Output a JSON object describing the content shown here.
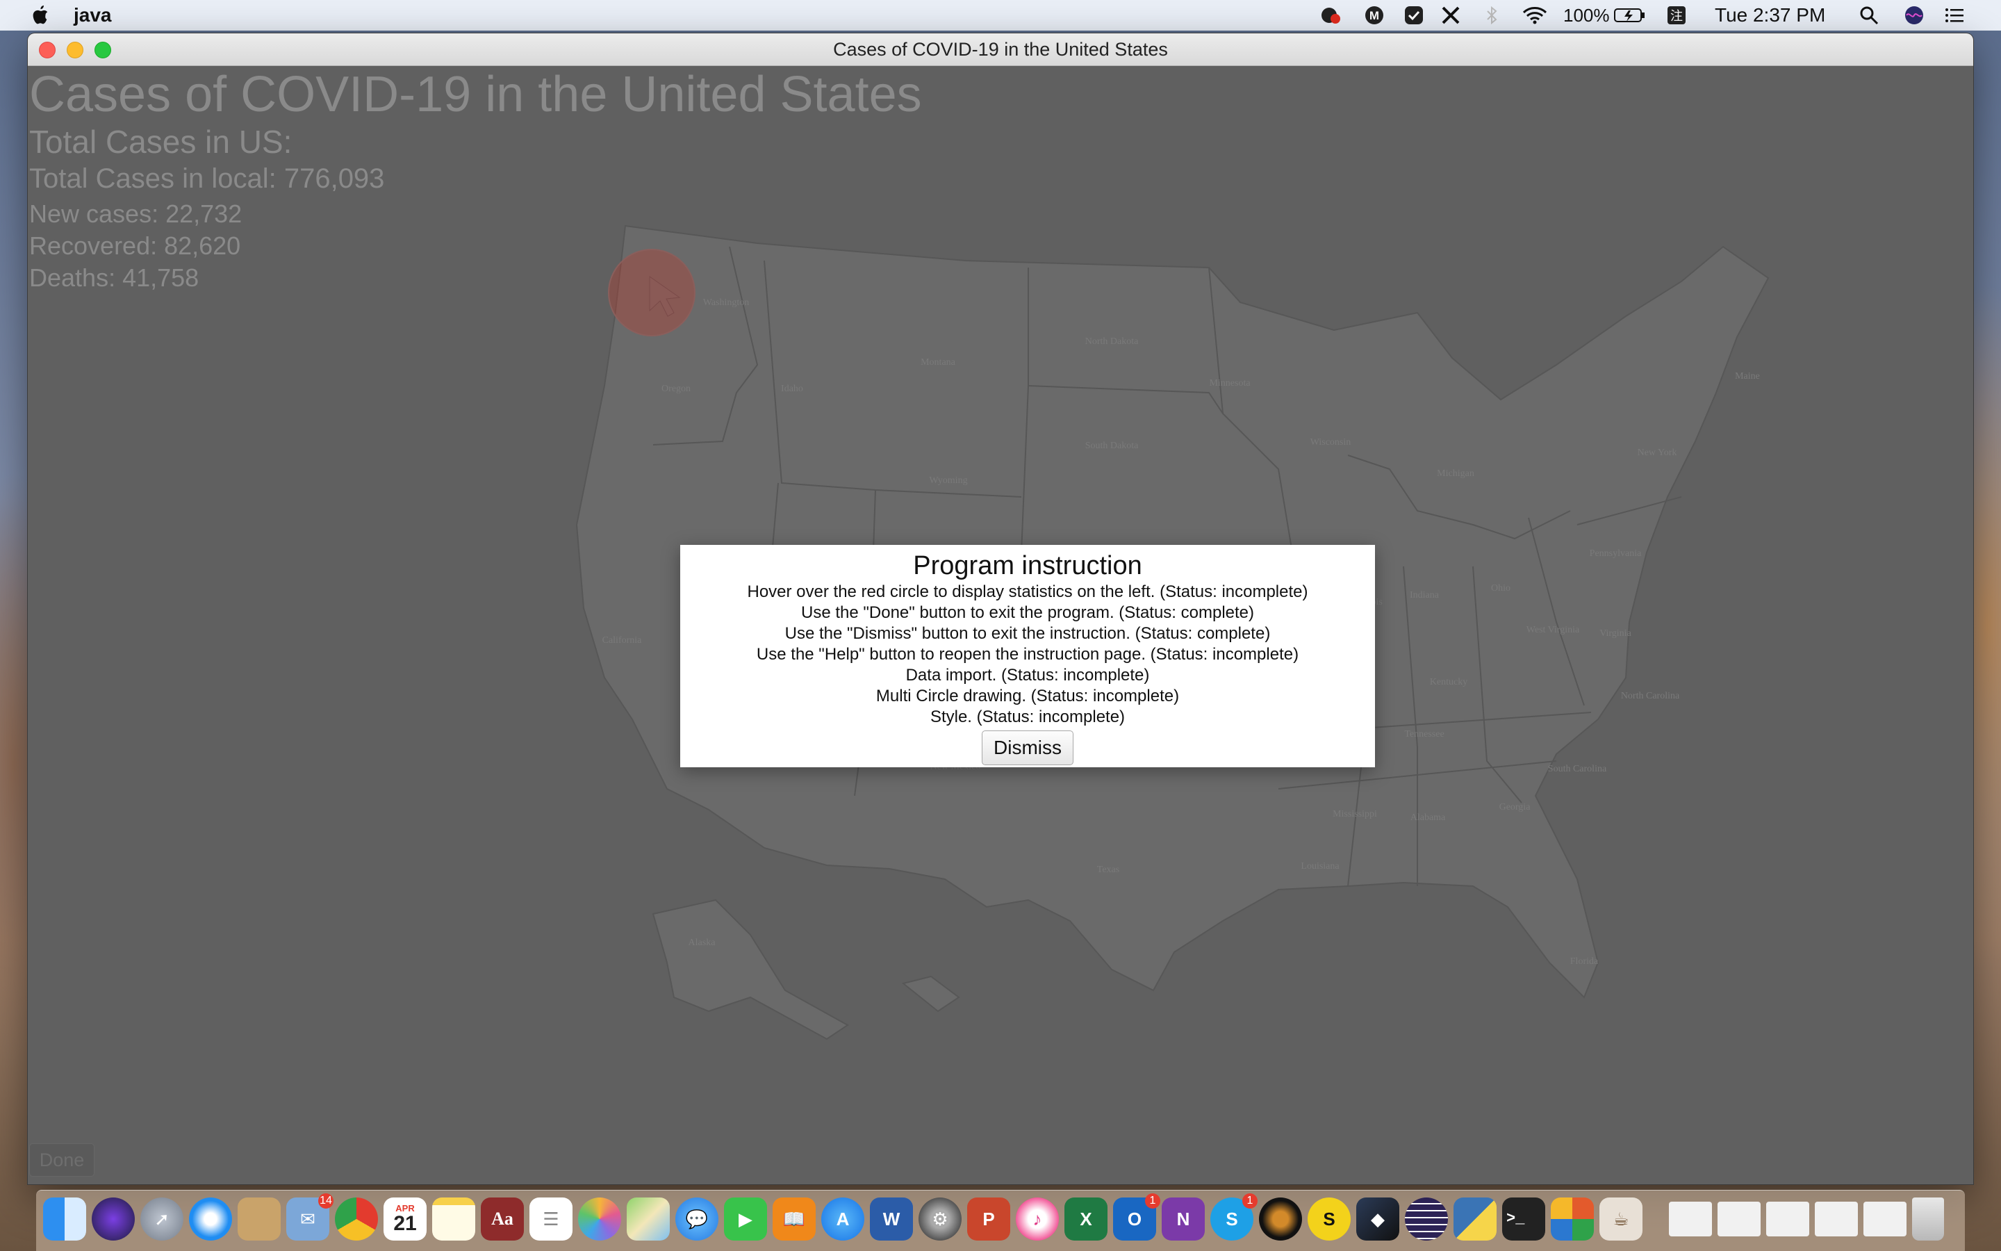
{
  "menubar": {
    "app_name": "java",
    "battery": "100%",
    "clock": "Tue 2:37 PM"
  },
  "window": {
    "title": "Cases of COVID-19 in the United States"
  },
  "stats": {
    "title": "Cases of COVID-19 in the United States",
    "total_us": "Total Cases in US:",
    "total_local": "Total Cases in local: 776,093",
    "new_cases": "New cases: 22,732",
    "recovered": "Recovered: 82,620",
    "deaths": "Deaths: 41,758"
  },
  "map": {
    "states": [
      "Washington",
      "Oregon",
      "Idaho",
      "Montana",
      "North Dakota",
      "Minnesota",
      "South Dakota",
      "Wyoming",
      "Wisconsin",
      "Michigan",
      "New York",
      "Pennsylvania",
      "Ohio",
      "Indiana",
      "Illinois",
      "Kentucky",
      "West Virginia",
      "Virginia",
      "North Carolina",
      "Tennessee",
      "South Carolina",
      "Georgia",
      "Alabama",
      "Mississippi",
      "Louisiana",
      "Texas",
      "New Mexico",
      "California",
      "Alaska",
      "Florida",
      "Maine"
    ],
    "circle_color": "#c0392b"
  },
  "buttons": {
    "done": "Done",
    "dismiss": "Dismiss"
  },
  "dialog": {
    "title": "Program instruction",
    "lines": [
      "Hover over the red circle to display statistics on the left. (Status: incomplete)",
      "Use the \"Done\" button to exit the program. (Status: complete)",
      "Use the \"Dismiss\" button to exit the instruction. (Status: complete)",
      "Use the \"Help\" button to reopen the instruction page. (Status: incomplete)",
      "Data import. (Status: incomplete)",
      "Multi Circle drawing. (Status: incomplete)",
      "Style. (Status: incomplete)"
    ]
  },
  "dock": {
    "badges": {
      "mail": "14",
      "calendar_day": "21",
      "calendar_month": "APR",
      "outlook": "1",
      "skype": "1"
    }
  }
}
